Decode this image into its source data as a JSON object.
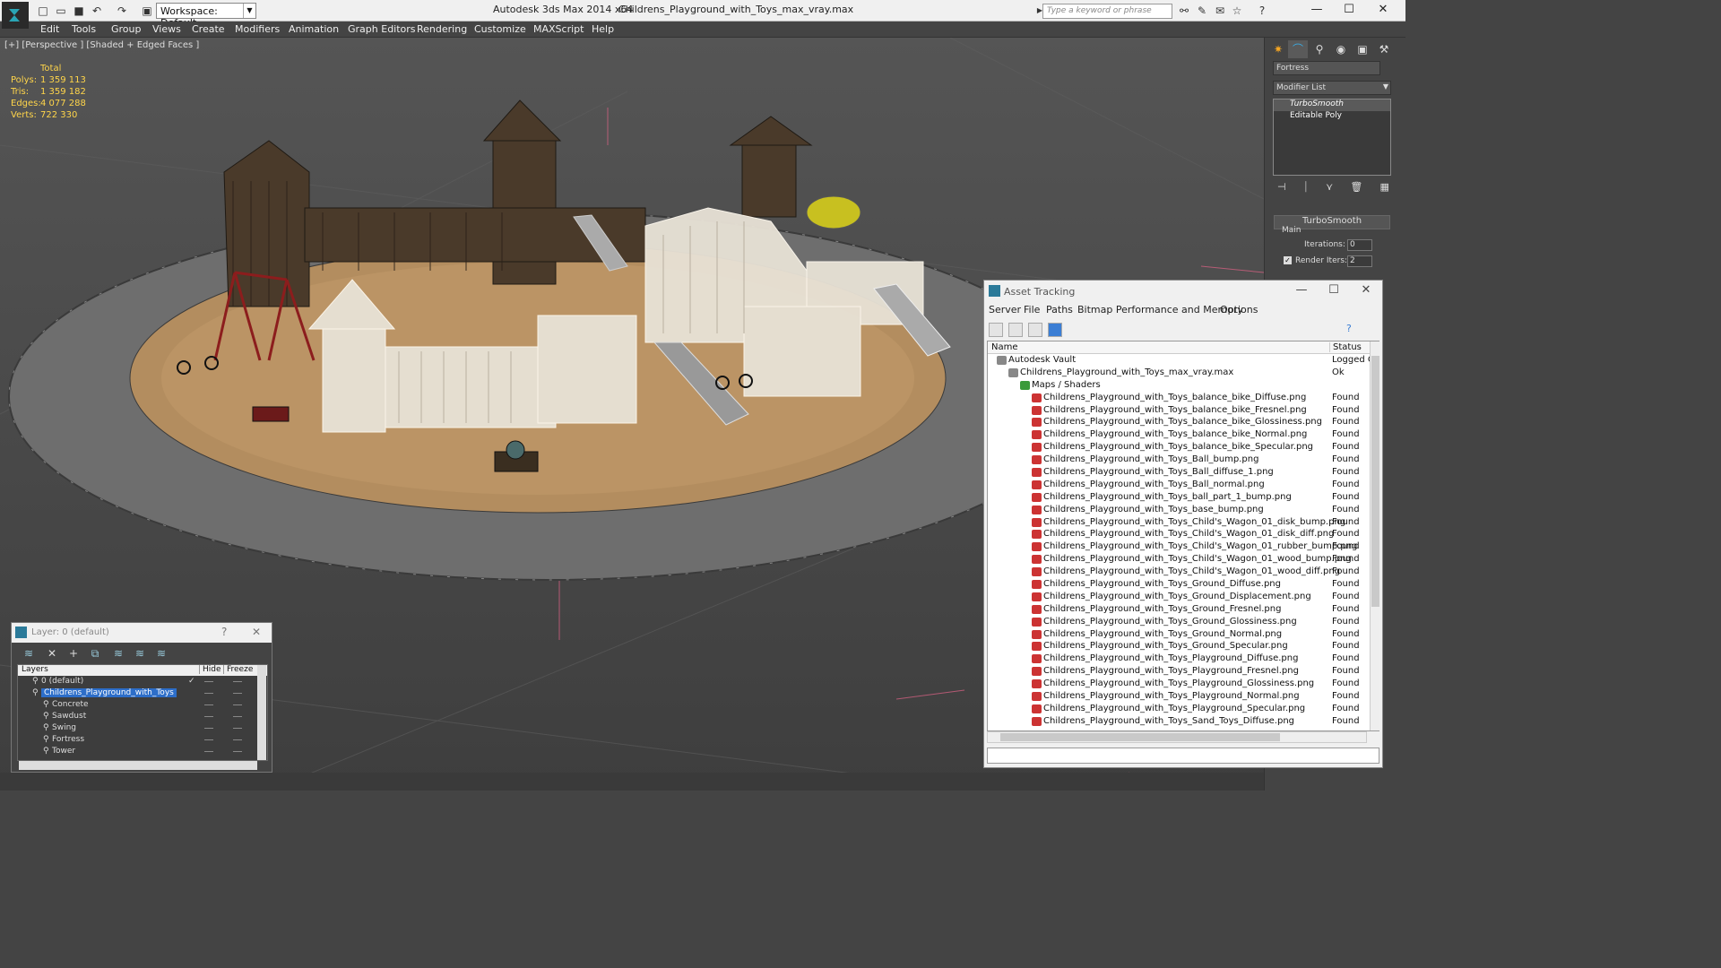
{
  "titlebar": {
    "workspace": "Workspace: Default",
    "app": "Autodesk 3ds Max  2014 x64",
    "file": "Childrens_Playground_with_Toys_max_vray.max",
    "search_placeholder": "Type a keyword or phrase"
  },
  "menu": [
    "Edit",
    "Tools",
    "Group",
    "Views",
    "Create",
    "Modifiers",
    "Animation",
    "Graph Editors",
    "Rendering",
    "Customize",
    "MAXScript",
    "Help"
  ],
  "viewport": {
    "label": "[+] [Perspective ] [Shaded + Edged Faces ]",
    "stats": {
      "header": "Total",
      "rows": [
        {
          "k": "Polys:",
          "v": "1 359 113"
        },
        {
          "k": "Tris:",
          "v": "1 359 182"
        },
        {
          "k": "Edges:",
          "v": "4 077 288"
        },
        {
          "k": "Verts:",
          "v": "722 330"
        }
      ]
    }
  },
  "command_panel": {
    "object_name": "Fortress",
    "modifier_list": "Modifier List",
    "stack": [
      "TurboSmooth",
      "Editable Poly"
    ],
    "rollout": "TurboSmooth",
    "group": "Main",
    "iterations_label": "Iterations:",
    "iterations": "0",
    "render_iters_label": "Render Iters:",
    "render_iters": "2"
  },
  "asset": {
    "title": "Asset Tracking",
    "menu": [
      "Server",
      "File",
      "Paths",
      "Bitmap Performance and Memory",
      "Options"
    ],
    "col_name": "Name",
    "col_status": "Status",
    "rows": [
      {
        "name": "Autodesk Vault",
        "status": "Logged O",
        "indent": 0
      },
      {
        "name": "Childrens_Playground_with_Toys_max_vray.max",
        "status": "Ok",
        "indent": 1
      },
      {
        "name": "Maps / Shaders",
        "status": "",
        "indent": 2
      },
      {
        "name": "Childrens_Playground_with_Toys_balance_bike_Diffuse.png",
        "status": "Found",
        "indent": 3
      },
      {
        "name": "Childrens_Playground_with_Toys_balance_bike_Fresnel.png",
        "status": "Found",
        "indent": 3
      },
      {
        "name": "Childrens_Playground_with_Toys_balance_bike_Glossiness.png",
        "status": "Found",
        "indent": 3
      },
      {
        "name": "Childrens_Playground_with_Toys_balance_bike_Normal.png",
        "status": "Found",
        "indent": 3
      },
      {
        "name": "Childrens_Playground_with_Toys_balance_bike_Specular.png",
        "status": "Found",
        "indent": 3
      },
      {
        "name": "Childrens_Playground_with_Toys_Ball_bump.png",
        "status": "Found",
        "indent": 3
      },
      {
        "name": "Childrens_Playground_with_Toys_Ball_diffuse_1.png",
        "status": "Found",
        "indent": 3
      },
      {
        "name": "Childrens_Playground_with_Toys_Ball_normal.png",
        "status": "Found",
        "indent": 3
      },
      {
        "name": "Childrens_Playground_with_Toys_ball_part_1_bump.png",
        "status": "Found",
        "indent": 3
      },
      {
        "name": "Childrens_Playground_with_Toys_base_bump.png",
        "status": "Found",
        "indent": 3
      },
      {
        "name": "Childrens_Playground_with_Toys_Child's_Wagon_01_disk_bump.png",
        "status": "Found",
        "indent": 3
      },
      {
        "name": "Childrens_Playground_with_Toys_Child's_Wagon_01_disk_diff.png",
        "status": "Found",
        "indent": 3
      },
      {
        "name": "Childrens_Playground_with_Toys_Child's_Wagon_01_rubber_bump.png",
        "status": "Found",
        "indent": 3
      },
      {
        "name": "Childrens_Playground_with_Toys_Child's_Wagon_01_wood_bump.png",
        "status": "Found",
        "indent": 3
      },
      {
        "name": "Childrens_Playground_with_Toys_Child's_Wagon_01_wood_diff.png",
        "status": "Found",
        "indent": 3
      },
      {
        "name": "Childrens_Playground_with_Toys_Ground_Diffuse.png",
        "status": "Found",
        "indent": 3
      },
      {
        "name": "Childrens_Playground_with_Toys_Ground_Displacement.png",
        "status": "Found",
        "indent": 3
      },
      {
        "name": "Childrens_Playground_with_Toys_Ground_Fresnel.png",
        "status": "Found",
        "indent": 3
      },
      {
        "name": "Childrens_Playground_with_Toys_Ground_Glossiness.png",
        "status": "Found",
        "indent": 3
      },
      {
        "name": "Childrens_Playground_with_Toys_Ground_Normal.png",
        "status": "Found",
        "indent": 3
      },
      {
        "name": "Childrens_Playground_with_Toys_Ground_Specular.png",
        "status": "Found",
        "indent": 3
      },
      {
        "name": "Childrens_Playground_with_Toys_Playground_Diffuse.png",
        "status": "Found",
        "indent": 3
      },
      {
        "name": "Childrens_Playground_with_Toys_Playground_Fresnel.png",
        "status": "Found",
        "indent": 3
      },
      {
        "name": "Childrens_Playground_with_Toys_Playground_Glossiness.png",
        "status": "Found",
        "indent": 3
      },
      {
        "name": "Childrens_Playground_with_Toys_Playground_Normal.png",
        "status": "Found",
        "indent": 3
      },
      {
        "name": "Childrens_Playground_with_Toys_Playground_Specular.png",
        "status": "Found",
        "indent": 3
      },
      {
        "name": "Childrens_Playground_with_Toys_Sand_Toys_Diffuse.png",
        "status": "Found",
        "indent": 3
      }
    ]
  },
  "layer": {
    "title": "Layer: 0 (default)",
    "help": "?",
    "col_layers": "Layers",
    "col_hide": "Hide",
    "col_freeze": "Freeze",
    "rows": [
      {
        "name": "0 (default)",
        "indent": 0
      },
      {
        "name": "Childrens_Playground_with_Toys",
        "indent": 0
      },
      {
        "name": "Concrete",
        "indent": 1
      },
      {
        "name": "Sawdust",
        "indent": 1
      },
      {
        "name": "Swing",
        "indent": 1
      },
      {
        "name": "Fortress",
        "indent": 1
      },
      {
        "name": "Tower",
        "indent": 1
      }
    ]
  }
}
